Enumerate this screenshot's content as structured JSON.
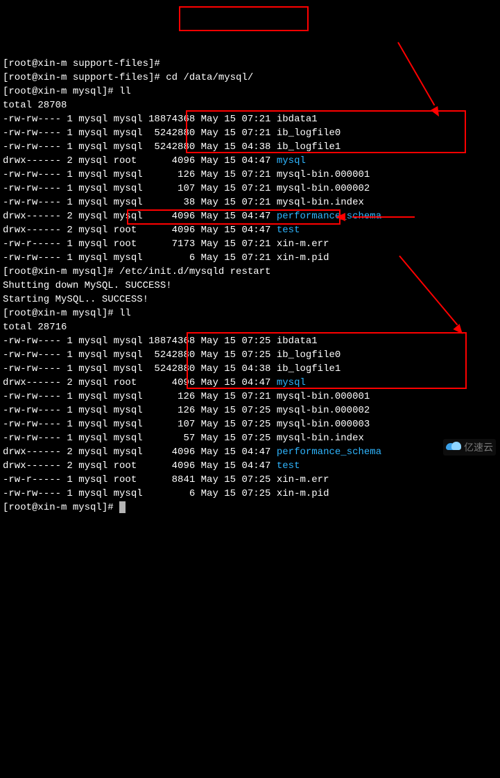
{
  "prompts": {
    "support_files": "[root@xin-m support-files]#",
    "mysql": "[root@xin-m mysql]#"
  },
  "cmds": {
    "cd": "cd /data/mysql/",
    "ll": "ll",
    "restart": "/etc/init.d/mysqld restart"
  },
  "totals": {
    "first": "total 28708",
    "second": "total 28716"
  },
  "restart_out": {
    "shut": "Shutting down MySQL. SUCCESS!",
    "start": "Starting MySQL.. SUCCESS!"
  },
  "ls1": [
    {
      "perm": "-rw-rw----",
      "links": "1",
      "user": "mysql",
      "group": "mysql",
      "size": "18874368",
      "mon": "May",
      "day": "15",
      "time": "07:21",
      "name": "ibdata1",
      "cls": ""
    },
    {
      "perm": "-rw-rw----",
      "links": "1",
      "user": "mysql",
      "group": "mysql",
      "size": " 5242880",
      "mon": "May",
      "day": "15",
      "time": "07:21",
      "name": "ib_logfile0",
      "cls": ""
    },
    {
      "perm": "-rw-rw----",
      "links": "1",
      "user": "mysql",
      "group": "mysql",
      "size": " 5242880",
      "mon": "May",
      "day": "15",
      "time": "04:38",
      "name": "ib_logfile1",
      "cls": ""
    },
    {
      "perm": "drwx------",
      "links": "2",
      "user": "mysql",
      "group": "root ",
      "size": "    4096",
      "mon": "May",
      "day": "15",
      "time": "04:47",
      "name": "mysql",
      "cls": "cyan"
    },
    {
      "perm": "-rw-rw----",
      "links": "1",
      "user": "mysql",
      "group": "mysql",
      "size": "     126",
      "mon": "May",
      "day": "15",
      "time": "07:21",
      "name": "mysql-bin.000001",
      "cls": ""
    },
    {
      "perm": "-rw-rw----",
      "links": "1",
      "user": "mysql",
      "group": "mysql",
      "size": "     107",
      "mon": "May",
      "day": "15",
      "time": "07:21",
      "name": "mysql-bin.000002",
      "cls": ""
    },
    {
      "perm": "-rw-rw----",
      "links": "1",
      "user": "mysql",
      "group": "mysql",
      "size": "      38",
      "mon": "May",
      "day": "15",
      "time": "07:21",
      "name": "mysql-bin.index",
      "cls": ""
    },
    {
      "perm": "drwx------",
      "links": "2",
      "user": "mysql",
      "group": "mysql",
      "size": "    4096",
      "mon": "May",
      "day": "15",
      "time": "04:47",
      "name": "performance_schema",
      "cls": "cyan"
    },
    {
      "perm": "drwx------",
      "links": "2",
      "user": "mysql",
      "group": "root ",
      "size": "    4096",
      "mon": "May",
      "day": "15",
      "time": "04:47",
      "name": "test",
      "cls": "cyan"
    },
    {
      "perm": "-rw-r-----",
      "links": "1",
      "user": "mysql",
      "group": "root ",
      "size": "    7173",
      "mon": "May",
      "day": "15",
      "time": "07:21",
      "name": "xin-m.err",
      "cls": ""
    },
    {
      "perm": "-rw-rw----",
      "links": "1",
      "user": "mysql",
      "group": "mysql",
      "size": "       6",
      "mon": "May",
      "day": "15",
      "time": "07:21",
      "name": "xin-m.pid",
      "cls": ""
    }
  ],
  "ls2": [
    {
      "perm": "-rw-rw----",
      "links": "1",
      "user": "mysql",
      "group": "mysql",
      "size": "18874368",
      "mon": "May",
      "day": "15",
      "time": "07:25",
      "name": "ibdata1",
      "cls": ""
    },
    {
      "perm": "-rw-rw----",
      "links": "1",
      "user": "mysql",
      "group": "mysql",
      "size": " 5242880",
      "mon": "May",
      "day": "15",
      "time": "07:25",
      "name": "ib_logfile0",
      "cls": ""
    },
    {
      "perm": "-rw-rw----",
      "links": "1",
      "user": "mysql",
      "group": "mysql",
      "size": " 5242880",
      "mon": "May",
      "day": "15",
      "time": "04:38",
      "name": "ib_logfile1",
      "cls": ""
    },
    {
      "perm": "drwx------",
      "links": "2",
      "user": "mysql",
      "group": "root ",
      "size": "    4096",
      "mon": "May",
      "day": "15",
      "time": "04:47",
      "name": "mysql",
      "cls": "cyan"
    },
    {
      "perm": "-rw-rw----",
      "links": "1",
      "user": "mysql",
      "group": "mysql",
      "size": "     126",
      "mon": "May",
      "day": "15",
      "time": "07:21",
      "name": "mysql-bin.000001",
      "cls": ""
    },
    {
      "perm": "-rw-rw----",
      "links": "1",
      "user": "mysql",
      "group": "mysql",
      "size": "     126",
      "mon": "May",
      "day": "15",
      "time": "07:25",
      "name": "mysql-bin.000002",
      "cls": ""
    },
    {
      "perm": "-rw-rw----",
      "links": "1",
      "user": "mysql",
      "group": "mysql",
      "size": "     107",
      "mon": "May",
      "day": "15",
      "time": "07:25",
      "name": "mysql-bin.000003",
      "cls": ""
    },
    {
      "perm": "-rw-rw----",
      "links": "1",
      "user": "mysql",
      "group": "mysql",
      "size": "      57",
      "mon": "May",
      "day": "15",
      "time": "07:25",
      "name": "mysql-bin.index",
      "cls": ""
    },
    {
      "perm": "drwx------",
      "links": "2",
      "user": "mysql",
      "group": "mysql",
      "size": "    4096",
      "mon": "May",
      "day": "15",
      "time": "04:47",
      "name": "performance_schema",
      "cls": "cyan"
    },
    {
      "perm": "drwx------",
      "links": "2",
      "user": "mysql",
      "group": "root ",
      "size": "    4096",
      "mon": "May",
      "day": "15",
      "time": "04:47",
      "name": "test",
      "cls": "cyan"
    },
    {
      "perm": "-rw-r-----",
      "links": "1",
      "user": "mysql",
      "group": "root ",
      "size": "    8841",
      "mon": "May",
      "day": "15",
      "time": "07:25",
      "name": "xin-m.err",
      "cls": ""
    },
    {
      "perm": "-rw-rw----",
      "links": "1",
      "user": "mysql",
      "group": "mysql",
      "size": "       6",
      "mon": "May",
      "day": "15",
      "time": "07:25",
      "name": "xin-m.pid",
      "cls": ""
    }
  ],
  "watermark": "亿速云"
}
